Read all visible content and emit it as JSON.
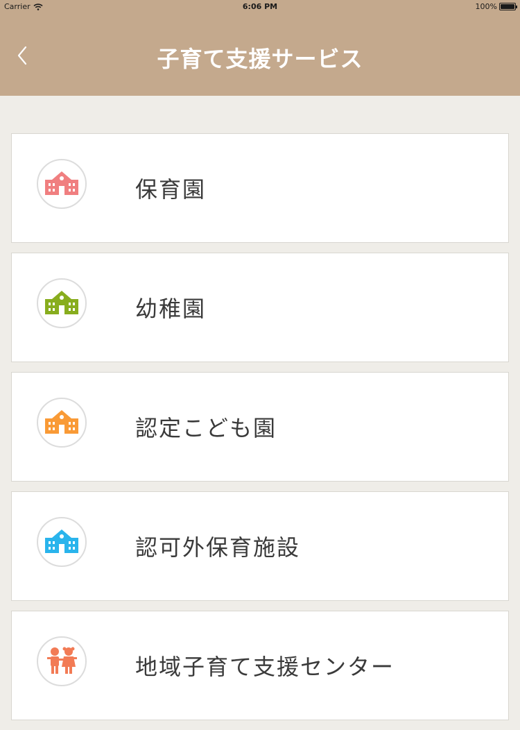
{
  "status_bar": {
    "carrier": "Carrier",
    "time": "6:06 PM",
    "battery": "100%"
  },
  "nav": {
    "title": "子育て支援サービス",
    "back_icon": "chevron-left-icon"
  },
  "colors": {
    "nav_background": "#c4a98d",
    "page_background": "#efede8"
  },
  "items": [
    {
      "label": "保育園",
      "icon": "school-building-icon",
      "color": "#f07f80"
    },
    {
      "label": "幼稚園",
      "icon": "school-building-icon",
      "color": "#88ad1e"
    },
    {
      "label": "認定こども園",
      "icon": "school-building-icon",
      "color": "#f99a36"
    },
    {
      "label": "認可外保育施設",
      "icon": "school-building-icon",
      "color": "#2ab4ec"
    },
    {
      "label": "地域子育て支援センター",
      "icon": "children-icon",
      "color": "#f27b55"
    }
  ]
}
